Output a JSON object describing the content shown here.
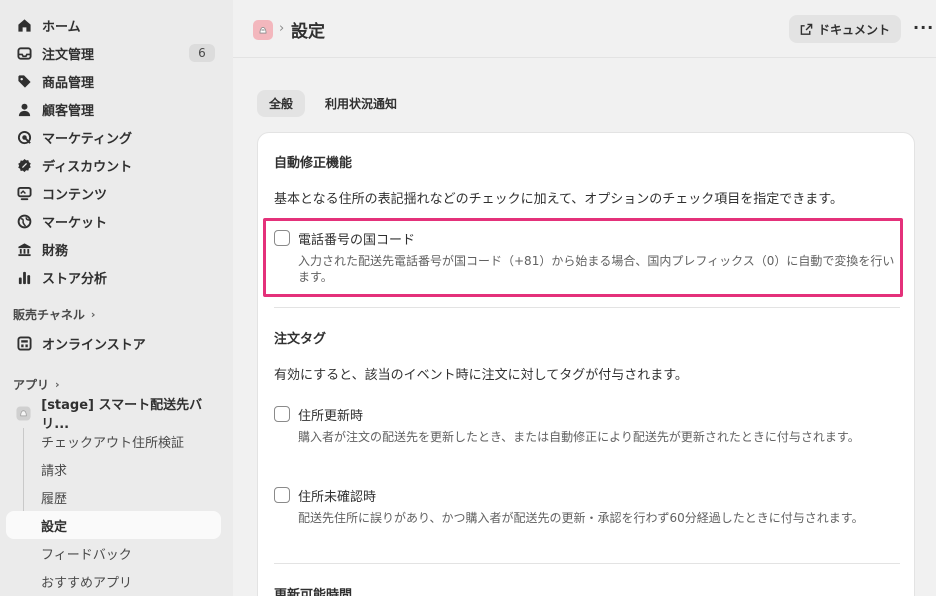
{
  "sidebar": {
    "items": [
      {
        "label": "ホーム",
        "icon": "home-icon"
      },
      {
        "label": "注文管理",
        "icon": "inbox-icon",
        "badge": "6"
      },
      {
        "label": "商品管理",
        "icon": "tag-icon"
      },
      {
        "label": "顧客管理",
        "icon": "person-icon"
      },
      {
        "label": "マーケティング",
        "icon": "target-icon"
      },
      {
        "label": "ディスカウント",
        "icon": "discount-icon"
      },
      {
        "label": "コンテンツ",
        "icon": "content-icon"
      },
      {
        "label": "マーケット",
        "icon": "globe-icon"
      },
      {
        "label": "財務",
        "icon": "bank-icon"
      },
      {
        "label": "ストア分析",
        "icon": "bar-chart-icon"
      }
    ],
    "sales_channels": {
      "label": "販売チャネル",
      "items": [
        {
          "label": "オンラインストア",
          "icon": "store-icon"
        }
      ]
    },
    "apps": {
      "label": "アプリ",
      "app_name": "[stage] スマート配送先バリ...",
      "sub_items": [
        "チェックアウト住所検証",
        "請求",
        "履歴",
        "設定",
        "フィードバック",
        "おすすめアプリ"
      ],
      "active": "設定"
    }
  },
  "header": {
    "title": "設定",
    "breadcrumb_sep": "›",
    "doc_button": "ドキュメント",
    "more": "···"
  },
  "tabs": [
    {
      "label": "全般",
      "active": true
    },
    {
      "label": "利用状況通知",
      "active": false
    }
  ],
  "auto_fix": {
    "title": "自動修正機能",
    "description": "基本となる住所の表記揺れなどのチェックに加えて、オプションのチェック項目を指定できます。",
    "option": {
      "label": "電話番号の国コード",
      "help_line1": "入力された配送先電話番号が国コード（+81）から始まる場合、国内プレフィックス（0）に自動で変換を行い",
      "help_line2": "ます。",
      "checked": false
    }
  },
  "order_tags": {
    "title": "注文タグ",
    "description": "有効にすると、該当のイベント時に注文に対してタグが付与されます。",
    "options": [
      {
        "label": "住所更新時",
        "help": "購入者が注文の配送先を更新したとき、または自動修正により配送先が更新されたときに付与されます。",
        "checked": false
      },
      {
        "label": "住所未確認時",
        "help": "配送先住所に誤りがあり、かつ購入者が配送先の更新・承認を行わず60分経過したときに付与されます。",
        "checked": false
      }
    ]
  },
  "next_section": {
    "title": "更新可能時間"
  },
  "colors": {
    "highlight": "#e4317a",
    "sidebar_bg": "#ebebeb",
    "page_bg": "#f1f1f1"
  }
}
